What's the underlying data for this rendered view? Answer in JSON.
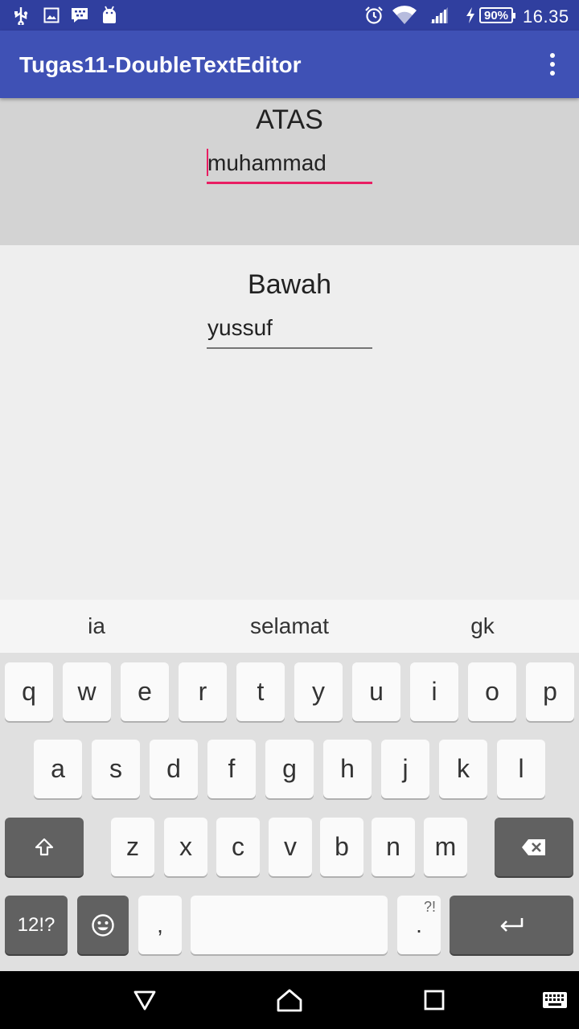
{
  "status_bar": {
    "icons": [
      "usb-icon",
      "image-icon",
      "bbm-icon",
      "android-icon",
      "alarm-icon",
      "wifi-icon",
      "signal-icon",
      "charging-icon"
    ],
    "battery": "90%",
    "time": "16.35"
  },
  "app_bar": {
    "title": "Tugas11-DoubleTextEditor",
    "menu_icon": "overflow-menu-icon"
  },
  "top_section": {
    "label": "ATAS",
    "input_value": "muhammad",
    "background": "#d3d3d3"
  },
  "bottom_section": {
    "label": "Bawah",
    "input_value": "yussuf",
    "background": "#eeeeee"
  },
  "keyboard": {
    "suggestions": [
      "ia",
      "selamat",
      "gk"
    ],
    "row1": [
      "q",
      "w",
      "e",
      "r",
      "t",
      "y",
      "u",
      "i",
      "o",
      "p"
    ],
    "row2": [
      "a",
      "s",
      "d",
      "f",
      "g",
      "h",
      "j",
      "k",
      "l"
    ],
    "row3": [
      "z",
      "x",
      "c",
      "v",
      "b",
      "n",
      "m"
    ],
    "symbols_label": "12!?",
    "comma": ",",
    "period": ".",
    "period_alt": "?!"
  },
  "colors": {
    "primary": "#3f51b5",
    "primary_dark": "#303f9f",
    "accent": "#e91e63"
  }
}
